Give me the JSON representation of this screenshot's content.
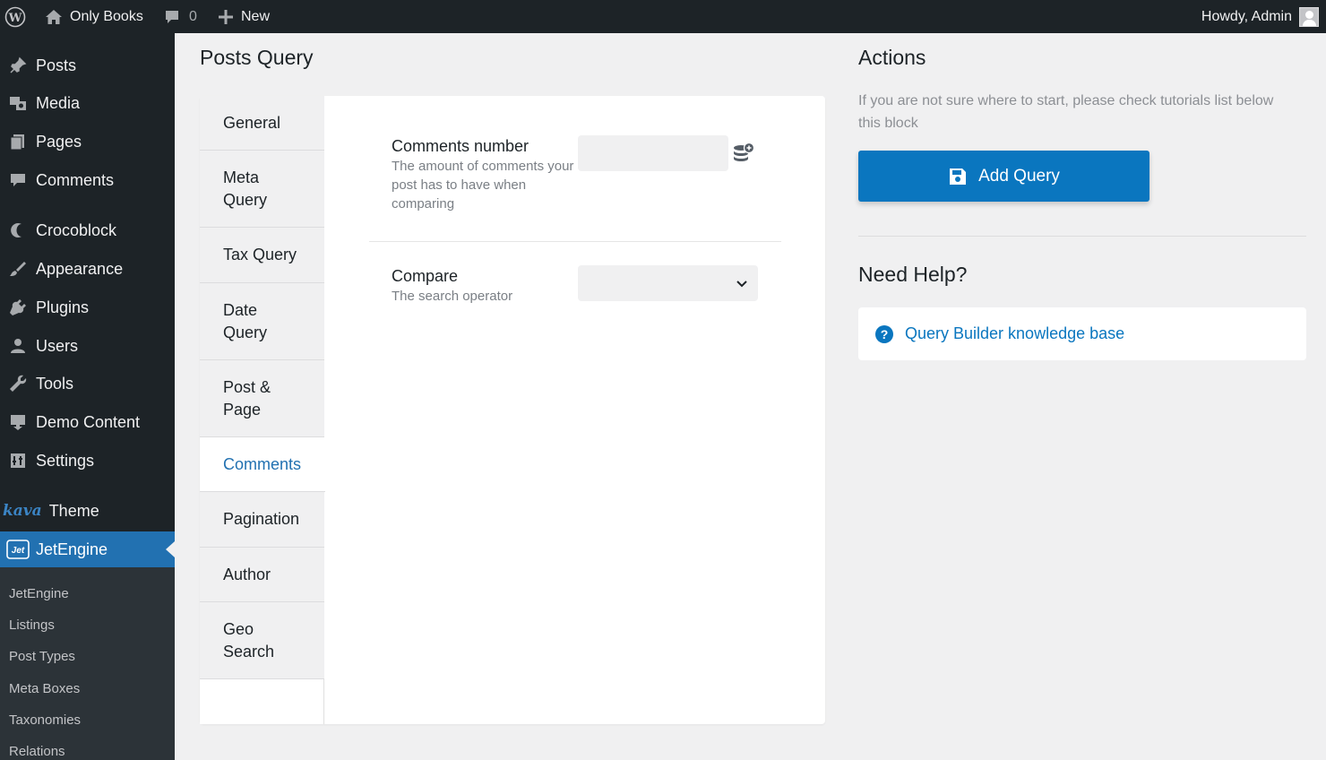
{
  "adminbar": {
    "site_name": "Only Books",
    "comments_count": "0",
    "new_label": "New",
    "howdy": "Howdy, Admin"
  },
  "sidebar": {
    "items": [
      {
        "label": "Posts",
        "icon": "pin-icon"
      },
      {
        "label": "Media",
        "icon": "media-icon"
      },
      {
        "label": "Pages",
        "icon": "pages-icon"
      },
      {
        "label": "Comments",
        "icon": "comment-icon"
      },
      {
        "label": "Crocoblock",
        "icon": "crocoblock-icon"
      },
      {
        "label": "Appearance",
        "icon": "brush-icon"
      },
      {
        "label": "Plugins",
        "icon": "plug-icon"
      },
      {
        "label": "Users",
        "icon": "user-icon"
      },
      {
        "label": "Tools",
        "icon": "wrench-icon"
      },
      {
        "label": "Demo Content",
        "icon": "download-icon"
      },
      {
        "label": "Settings",
        "icon": "settings-icon"
      },
      {
        "label": "Theme",
        "logo_text": "kava"
      },
      {
        "label": "JetEngine",
        "icon": "jet-icon",
        "current": true
      }
    ],
    "submenu": [
      "JetEngine",
      "Listings",
      "Post Types",
      "Meta Boxes",
      "Taxonomies",
      "Relations"
    ]
  },
  "main": {
    "title": "Posts Query",
    "tabs": [
      {
        "label": "General"
      },
      {
        "label": "Meta Query"
      },
      {
        "label": "Tax Query"
      },
      {
        "label": "Date Query"
      },
      {
        "label": "Post & Page"
      },
      {
        "label": "Comments",
        "active": true
      },
      {
        "label": "Pagination"
      },
      {
        "label": "Author"
      },
      {
        "label": "Geo Search"
      }
    ],
    "fields": {
      "comments_number": {
        "label": "Comments number",
        "description": "The amount of comments your post has to have when comparing",
        "value": ""
      },
      "compare": {
        "label": "Compare",
        "description": "The search operator",
        "selected": ""
      }
    }
  },
  "actions": {
    "title": "Actions",
    "text": "If you are not sure where to start, please check tutorials list below this block",
    "add_query_label": "Add Query",
    "accent": "#0a76bf"
  },
  "help": {
    "title": "Need Help?",
    "link_label": "Query Builder knowledge base"
  }
}
